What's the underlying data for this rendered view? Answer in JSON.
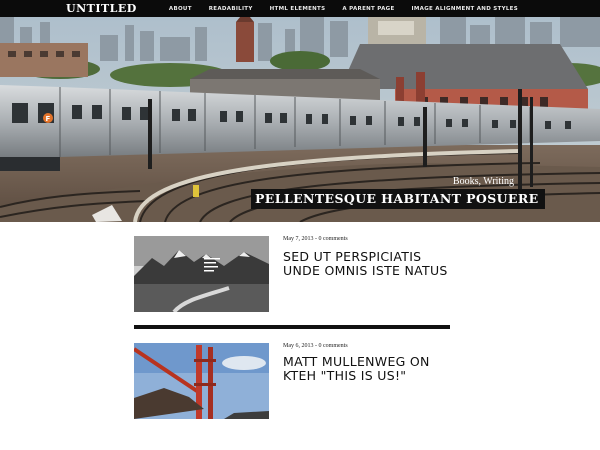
{
  "site": {
    "title": "UNTITLED"
  },
  "nav": {
    "items": [
      "About",
      "Readability",
      "HTML Elements",
      "A Parent Page",
      "Image Alignment and Styles"
    ]
  },
  "hero": {
    "categories": "Books, Writing",
    "title": "PELLENTESQUE HABITANT POSUERE",
    "image": "elevated subway train on curved track with city skyline"
  },
  "posts": [
    {
      "date": "May 7, 2013",
      "sep": " - ",
      "comments": "0 comments",
      "title": "SED UT PERSPICIATIS UNDE OMNIS ISTE NATUS",
      "image": "black and white mountain landscape"
    },
    {
      "date": "May 6, 2013",
      "sep": " - ",
      "comments": "0 comments",
      "title": "MATT MULLENWEG ON KTEH \"THIS IS US!\"",
      "image": "red suspension bridge tower"
    }
  ],
  "colors": {
    "topbar": "#0b0b0b",
    "divider": "#111111",
    "hero_title_bg": "#111111"
  }
}
